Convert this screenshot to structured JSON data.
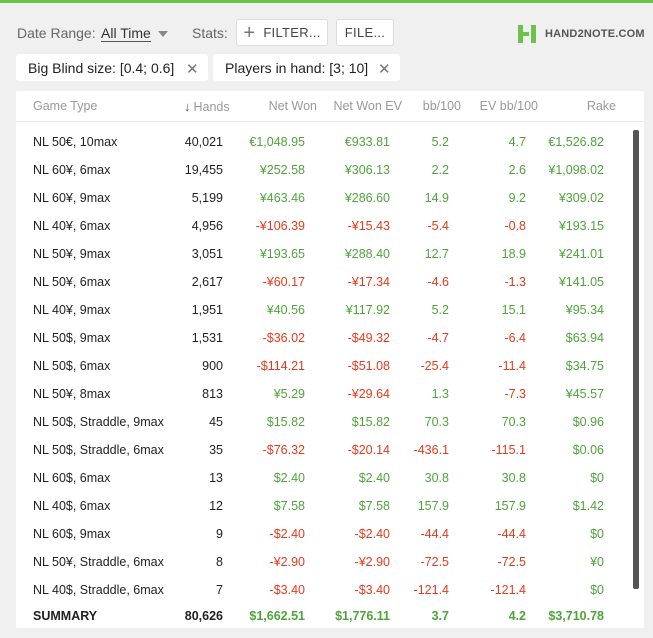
{
  "header": {
    "date_range_label": "Date Range:",
    "date_range_value": "All Time",
    "stats_label": "Stats:",
    "filter_button": "FILTER...",
    "file_button": "FILE...",
    "logo_text": "HAND2NOTE.COM"
  },
  "chips": [
    {
      "label": "Big Blind size: [0.4; 0.6]"
    },
    {
      "label": "Players in hand: [3; 10]"
    }
  ],
  "table": {
    "columns": [
      "Game Type",
      "Hands",
      "Net Won",
      "Net Won  EV",
      "bb/100",
      "EV bb/100",
      "Rake"
    ],
    "sort_icon": "arrow-down-icon",
    "rows": [
      {
        "game": "NL 50€, 10max",
        "hands": "40,021",
        "net": "€1,048.95",
        "netev": "€933.81",
        "bb": "5.2",
        "evbb": "4.7",
        "rake": "€1,526.82"
      },
      {
        "game": "NL 60¥, 6max",
        "hands": "19,455",
        "net": "¥252.58",
        "netev": "¥306.13",
        "bb": "2.2",
        "evbb": "2.6",
        "rake": "¥1,098.02"
      },
      {
        "game": "NL 60¥, 9max",
        "hands": "5,199",
        "net": "¥463.46",
        "netev": "¥286.60",
        "bb": "14.9",
        "evbb": "9.2",
        "rake": "¥309.02"
      },
      {
        "game": "NL 40¥, 6max",
        "hands": "4,956",
        "net": "-¥106.39",
        "netev": "-¥15.43",
        "bb": "-5.4",
        "evbb": "-0.8",
        "rake": "¥193.15"
      },
      {
        "game": "NL 50¥, 9max",
        "hands": "3,051",
        "net": "¥193.65",
        "netev": "¥288.40",
        "bb": "12.7",
        "evbb": "18.9",
        "rake": "¥241.01"
      },
      {
        "game": "NL 50¥, 6max",
        "hands": "2,617",
        "net": "-¥60.17",
        "netev": "-¥17.34",
        "bb": "-4.6",
        "evbb": "-1.3",
        "rake": "¥141.05"
      },
      {
        "game": "NL 40¥, 9max",
        "hands": "1,951",
        "net": "¥40.56",
        "netev": "¥117.92",
        "bb": "5.2",
        "evbb": "15.1",
        "rake": "¥95.34"
      },
      {
        "game": "NL 50$, 9max",
        "hands": "1,531",
        "net": "-$36.02",
        "netev": "-$49.32",
        "bb": "-4.7",
        "evbb": "-6.4",
        "rake": "$63.94"
      },
      {
        "game": "NL 50$, 6max",
        "hands": "900",
        "net": "-$114.21",
        "netev": "-$51.08",
        "bb": "-25.4",
        "evbb": "-11.4",
        "rake": "$34.75"
      },
      {
        "game": "NL 50¥, 8max",
        "hands": "813",
        "net": "¥5.29",
        "netev": "-¥29.64",
        "bb": "1.3",
        "evbb": "-7.3",
        "rake": "¥45.57"
      },
      {
        "game": "NL 50$, Straddle, 9max",
        "hands": "45",
        "net": "$15.82",
        "netev": "$15.82",
        "bb": "70.3",
        "evbb": "70.3",
        "rake": "$0.96"
      },
      {
        "game": "NL 50$, Straddle, 6max",
        "hands": "35",
        "net": "-$76.32",
        "netev": "-$20.14",
        "bb": "-436.1",
        "evbb": "-115.1",
        "rake": "$0.06"
      },
      {
        "game": "NL 60$, 6max",
        "hands": "13",
        "net": "$2.40",
        "netev": "$2.40",
        "bb": "30.8",
        "evbb": "30.8",
        "rake": "$0"
      },
      {
        "game": "NL 40$, 6max",
        "hands": "12",
        "net": "$7.58",
        "netev": "$7.58",
        "bb": "157.9",
        "evbb": "157.9",
        "rake": "$1.42"
      },
      {
        "game": "NL 60$, 9max",
        "hands": "9",
        "net": "-$2.40",
        "netev": "-$2.40",
        "bb": "-44.4",
        "evbb": "-44.4",
        "rake": "$0"
      },
      {
        "game": "NL 50¥, Straddle, 6max",
        "hands": "8",
        "net": "-¥2.90",
        "netev": "-¥2.90",
        "bb": "-72.5",
        "evbb": "-72.5",
        "rake": "¥0"
      },
      {
        "game": "NL 40$, Straddle, 6max",
        "hands": "7",
        "net": "-$3.40",
        "netev": "-$3.40",
        "bb": "-121.4",
        "evbb": "-121.4",
        "rake": "$0"
      }
    ],
    "summary": {
      "game": "SUMMARY",
      "hands": "80,626",
      "net": "$1,662.51",
      "netev": "$1,776.11",
      "bb": "3.7",
      "evbb": "4.2",
      "rake": "$3,710.78"
    }
  },
  "colors": {
    "positive": "#4ea43a",
    "negative": "#e23b1b",
    "accent": "#6ec24a"
  }
}
